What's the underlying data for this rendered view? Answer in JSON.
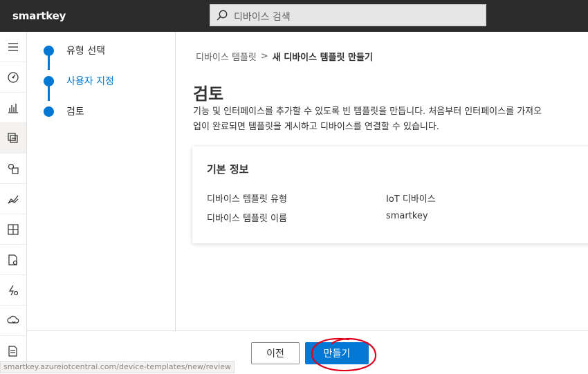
{
  "app": {
    "name": "smartkey"
  },
  "search": {
    "placeholder": "디바이스 검색"
  },
  "rail": {
    "items": [
      {
        "icon": "menu-icon"
      },
      {
        "icon": "dashboard-gauge-icon"
      },
      {
        "icon": "bar-chart-icon"
      },
      {
        "icon": "device-templates-icon",
        "active": true
      },
      {
        "icon": "device-groups-icon"
      },
      {
        "icon": "analytics-icon"
      },
      {
        "icon": "dashboards-grid-icon"
      },
      {
        "icon": "jobs-icon"
      },
      {
        "icon": "rules-icon"
      },
      {
        "icon": "data-export-icon"
      },
      {
        "icon": "audit-log-icon"
      }
    ]
  },
  "steps": [
    {
      "label": "유형 선택"
    },
    {
      "label": "사용자 지정"
    },
    {
      "label": "검토"
    }
  ],
  "breadcrumb": {
    "parent": "디바이스 템플릿",
    "separator": ">",
    "current": "새 디바이스 템플릿 만들기"
  },
  "page": {
    "title": "검토",
    "description_line1": "기능 및 인터페이스를 추가할 수 있도록 빈 템플릿을 만듭니다. 처음부터 인터페이스를 가져오",
    "description_line2": "업이 완료되면 템플릿을 게시하고 디바이스를 연결할 수 있습니다."
  },
  "card": {
    "title": "기본 정보",
    "rows": [
      {
        "key": "디바이스 템플릿 유형",
        "value": "IoT 디바이스"
      },
      {
        "key": "디바이스 템플릿 이름",
        "value": "smartkey"
      }
    ]
  },
  "footer": {
    "prev_label": "이전",
    "create_label": "만들기"
  },
  "status_url": "smartkey.azureiotcentral.com/device-templates/new/review",
  "colors": {
    "accent": "#0078d4",
    "topbar": "#2b2b2b",
    "annotation": "#e0001b"
  }
}
